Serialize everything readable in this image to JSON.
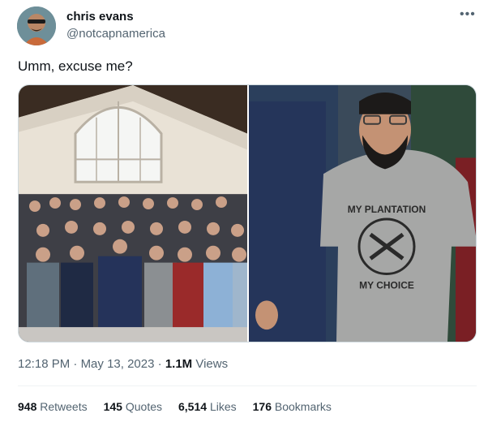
{
  "author": {
    "display_name": "chris evans",
    "handle": "@notcapnamerica"
  },
  "tweet": {
    "text": "Umm, excuse me?"
  },
  "media": {
    "right_shirt_top": "MY PLANTATION",
    "right_shirt_bottom": "MY CHOICE"
  },
  "meta": {
    "time": "12:18 PM",
    "separator": "·",
    "date": "May 13, 2023",
    "views_count": "1.1M",
    "views_label": "Views"
  },
  "stats": {
    "retweets_count": "948",
    "retweets_label": "Retweets",
    "quotes_count": "145",
    "quotes_label": "Quotes",
    "likes_count": "6,514",
    "likes_label": "Likes",
    "bookmarks_count": "176",
    "bookmarks_label": "Bookmarks"
  },
  "icons": {
    "more": "more-options-icon"
  }
}
